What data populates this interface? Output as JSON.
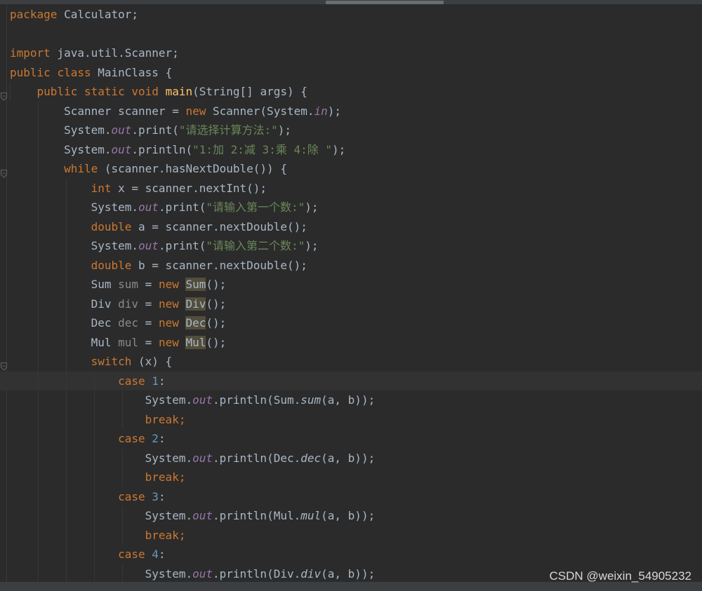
{
  "watermark": "CSDN @weixin_54905232",
  "colors": {
    "background": "#2b2b2b",
    "keyword": "#cc7832",
    "method": "#ffc66d",
    "string": "#6a8759",
    "number": "#6897bb",
    "static_field": "#9876aa",
    "text": "#a9b7c6"
  },
  "code": {
    "l01": {
      "a": "package",
      "b": " Calculator;"
    },
    "l03": {
      "a": "import",
      "b": " java.util.Scanner;"
    },
    "l04": {
      "a": "public",
      "b": " ",
      "c": "class",
      "d": " MainClass {"
    },
    "l05": {
      "a": "public",
      "b": " ",
      "c": "static",
      "d": " ",
      "e": "void",
      "f": " ",
      "g": "main",
      "h": "(String[] args) {"
    },
    "l06": {
      "a": "Scanner scanner = ",
      "b": "new",
      "c": " Scanner(System.",
      "d": "in",
      "e": ");"
    },
    "l07": {
      "a": "System.",
      "b": "out",
      "c": ".print(",
      "d": "\"请选择计算方法:\"",
      "e": ");"
    },
    "l08": {
      "a": "System.",
      "b": "out",
      "c": ".println(",
      "d": "\"1:加 2:减 3:乘 4:除 \"",
      "e": ");"
    },
    "l09": {
      "a": "while",
      "b": " (scanner.hasNextDouble()) {"
    },
    "l10": {
      "a": "int",
      "b": " x = scanner.nextInt();"
    },
    "l11": {
      "a": "System.",
      "b": "out",
      "c": ".print(",
      "d": "\"请输入第一个数:\"",
      "e": ");"
    },
    "l12": {
      "a": "double",
      "b": " a = scanner.nextDouble();"
    },
    "l13": {
      "a": "System.",
      "b": "out",
      "c": ".print(",
      "d": "\"请输入第二个数:\"",
      "e": ");"
    },
    "l14": {
      "a": "double",
      "b": " b = scanner.nextDouble();"
    },
    "l15": {
      "a": "Sum ",
      "b": "sum",
      "c": " = ",
      "d": "new",
      "e": " ",
      "f": "Sum",
      "g": "();"
    },
    "l16": {
      "a": "Div ",
      "b": "div",
      "c": " = ",
      "d": "new",
      "e": " ",
      "f": "Div",
      "g": "();"
    },
    "l17": {
      "a": "Dec ",
      "b": "dec",
      "c": " = ",
      "d": "new",
      "e": " ",
      "f": "Dec",
      "g": "();"
    },
    "l18": {
      "a": "Mul ",
      "b": "mul",
      "c": " = ",
      "d": "new",
      "e": " ",
      "f": "Mul",
      "g": "();"
    },
    "l19": {
      "a": "switch",
      "b": " (x) {"
    },
    "l20": {
      "a": "case",
      "b": " ",
      "c": "1",
      "d": ":"
    },
    "l21": {
      "a": "System.",
      "b": "out",
      "c": ".println(Sum.",
      "d": "sum",
      "e": "(a, b));"
    },
    "l22": {
      "a": "break",
      "b": ";"
    },
    "l23": {
      "a": "case",
      "b": " ",
      "c": "2",
      "d": ":"
    },
    "l24": {
      "a": "System.",
      "b": "out",
      "c": ".println(Dec.",
      "d": "dec",
      "e": "(a, b));"
    },
    "l25": {
      "a": "break",
      "b": ";"
    },
    "l26": {
      "a": "case",
      "b": " ",
      "c": "3",
      "d": ":"
    },
    "l27": {
      "a": "System.",
      "b": "out",
      "c": ".println(Mul.",
      "d": "mul",
      "e": "(a, b));"
    },
    "l28": {
      "a": "break",
      "b": ";"
    },
    "l29": {
      "a": "case",
      "b": " ",
      "c": "4",
      "d": ":"
    },
    "l30": {
      "a": "System.",
      "b": "out",
      "c": ".println(Div.",
      "d": "div",
      "e": "(a, b));"
    }
  }
}
